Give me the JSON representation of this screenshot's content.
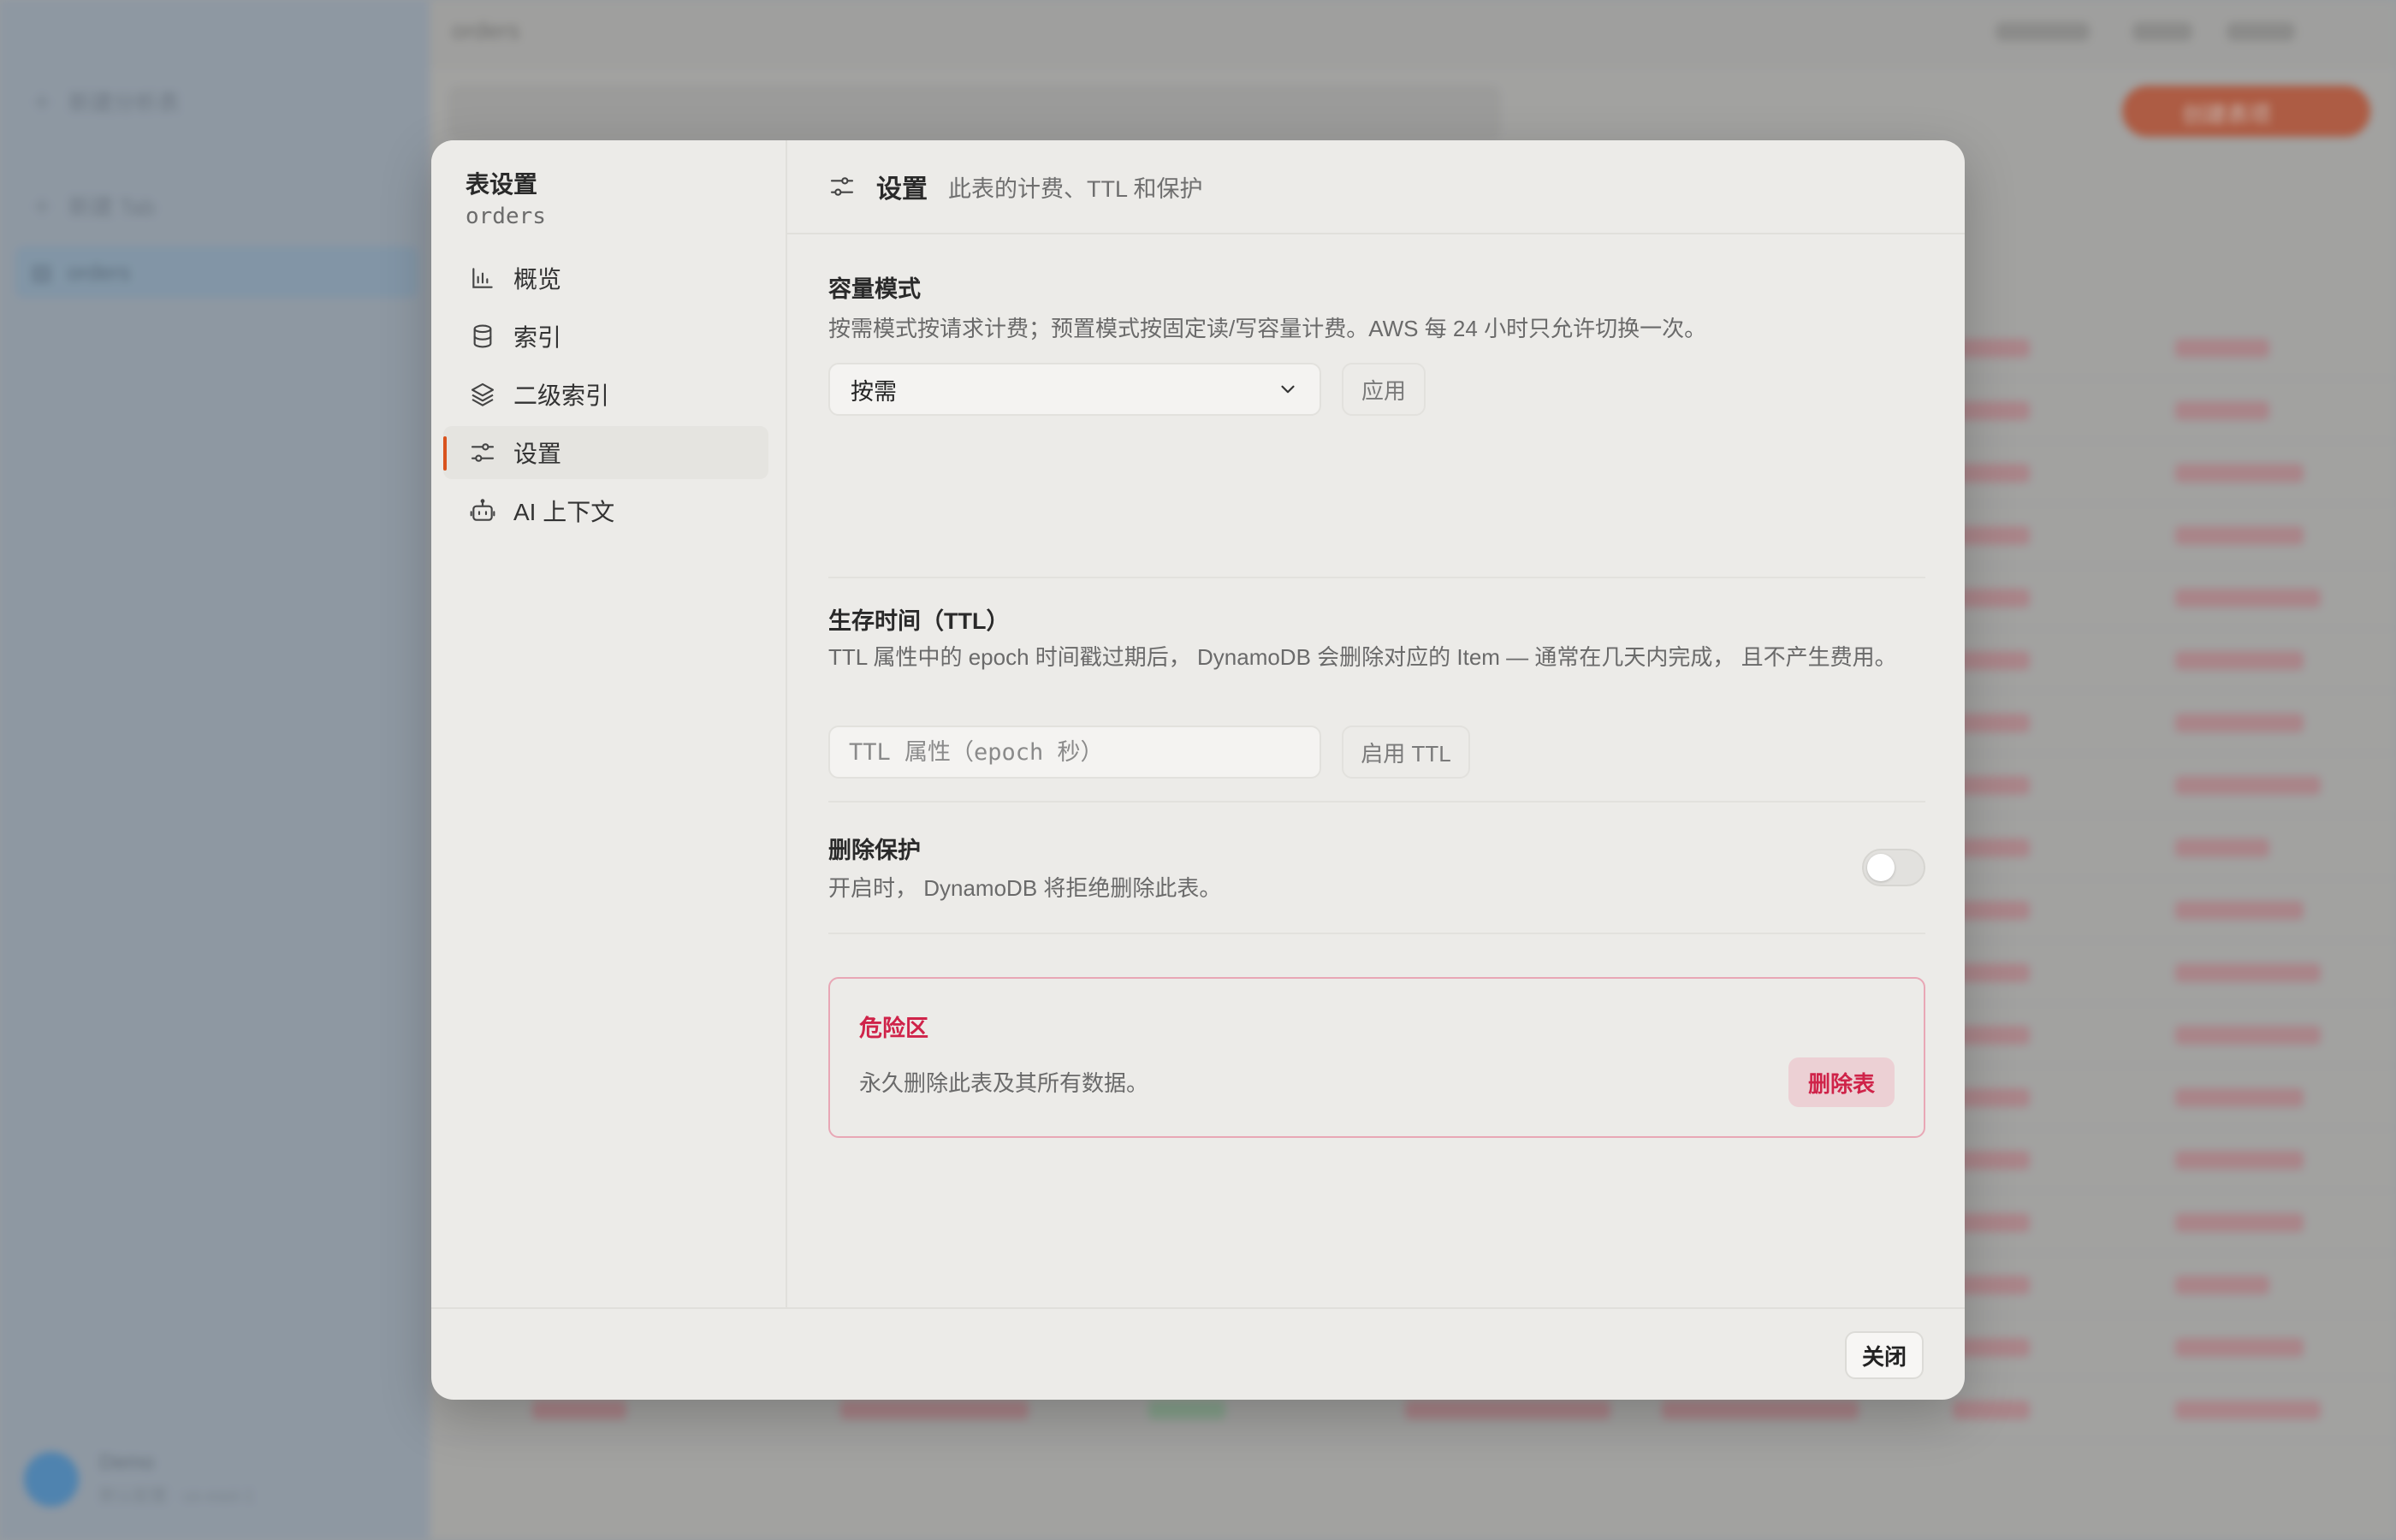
{
  "background": {
    "sidebar_items": [
      "新建分析表",
      "新建 Tab",
      "orders"
    ],
    "user_name": "Demo",
    "user_sub": "默认配置 · us-east-1",
    "table_name": "orders",
    "create_button": "创建表项"
  },
  "modal": {
    "sidebar": {
      "title": "表设置",
      "subtitle": "orders",
      "items": [
        {
          "label": "概览",
          "icon": "bar-chart-icon"
        },
        {
          "label": "索引",
          "icon": "database-icon"
        },
        {
          "label": "二级索引",
          "icon": "layers-icon"
        },
        {
          "label": "设置",
          "icon": "sliders-icon",
          "active": true
        },
        {
          "label": "AI 上下文",
          "icon": "bot-icon"
        }
      ]
    },
    "header": {
      "title": "设置",
      "subtitle": "此表的计费、TTL 和保护"
    },
    "capacity": {
      "title": "容量模式",
      "description": "按需模式按请求计费；预置模式按固定读/写容量计费。AWS 每 24 小时只允许切换一次。",
      "selected": "按需",
      "apply_label": "应用"
    },
    "ttl": {
      "title": "生存时间（TTL）",
      "description": "TTL 属性中的 epoch 时间戳过期后， DynamoDB 会删除对应的 Item — 通常在几天内完成， 且不产生费用。",
      "placeholder": "TTL 属性（epoch 秒）",
      "enable_label": "启用 TTL"
    },
    "deletion_protection": {
      "title": "删除保护",
      "description": "开启时， DynamoDB 将拒绝删除此表。",
      "enabled": false
    },
    "danger_zone": {
      "title": "危险区",
      "description": "永久删除此表及其所有数据。",
      "delete_label": "删除表"
    },
    "footer": {
      "close_label": "关闭"
    }
  },
  "colors": {
    "accent": "#d9531e",
    "danger": "#cf2349",
    "modal_bg": "#ecebe8"
  }
}
